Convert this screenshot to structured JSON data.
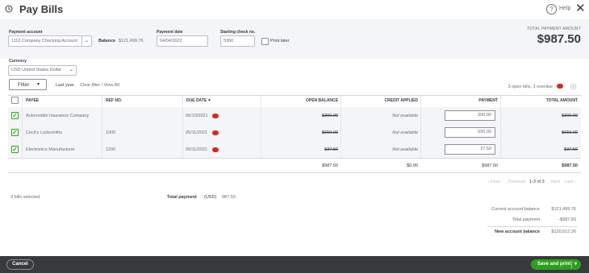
{
  "window": {
    "title": "Pay Bills",
    "help_label": "Help"
  },
  "header": {
    "payment_account_label": "Payment account",
    "payment_account_value": "1110 Company Checking Account",
    "balance_label": "Balance",
    "balance_value": "$121,499.76",
    "payment_date_label": "Payment date",
    "payment_date_value": "04/04/2022",
    "starting_check_label": "Starting check no.",
    "starting_check_value": "5360",
    "print_later_label": "Print later",
    "total_payment_label": "TOTAL PAYMENT AMOUNT",
    "total_payment_value": "$987.50"
  },
  "currency": {
    "label": "Currency",
    "value": "USD United States Dollar"
  },
  "filter": {
    "button_label": "Filter",
    "last_year": "Last year",
    "clear_filter": "Clear filter / View All",
    "summary": "3 open bills, 3 overdue"
  },
  "table": {
    "columns": [
      "PAYEE",
      "REF NO.",
      "DUE DATE",
      "OPEN BALANCE",
      "CREDIT APPLIED",
      "PAYMENT",
      "TOTAL AMOUNT"
    ],
    "rows": [
      {
        "payee": "Automobile Insurance Company",
        "ref": "",
        "due": "05/10/2021",
        "open": "$300.00",
        "credit": "Not available",
        "payment": "300.00",
        "total": "$300.00"
      },
      {
        "payee": "Cecil's Locksmiths",
        "ref": "1000",
        "due": "05/11/2021",
        "open": "$650.00",
        "credit": "Not available",
        "payment": "650.00",
        "total": "$650.00"
      },
      {
        "payee": "Electronics Manufacturer",
        "ref": "1200",
        "due": "05/11/2021",
        "open": "$37.50",
        "credit": "Not available",
        "payment": "37.50",
        "total": "$37.50"
      }
    ],
    "totals": {
      "open": "$987.50",
      "credit": "$0.00",
      "payment": "$987.50",
      "total": "$987.50"
    }
  },
  "pagination": {
    "first": "First",
    "previous": "Previous",
    "range": "1-3 of 3",
    "next": "Next",
    "last": "Last"
  },
  "summary": {
    "bills_selected": "3 bills selected",
    "total_payment_label": "Total payment",
    "total_payment_currency": "(USD)",
    "total_payment_value": "987.50",
    "current_balance_label": "Current account balance",
    "current_balance_value": "$121,499.76",
    "total_payment_line_label": "Total payment",
    "total_payment_line_value": "-$987.50",
    "new_balance_label": "New account balance",
    "new_balance_value": "$120,512.26"
  },
  "footer": {
    "cancel_label": "Cancel",
    "save_label": "Save and print"
  },
  "colors": {
    "accent": "#2ca01c",
    "footer": "#393a3d",
    "alert": "#d52b1e"
  }
}
